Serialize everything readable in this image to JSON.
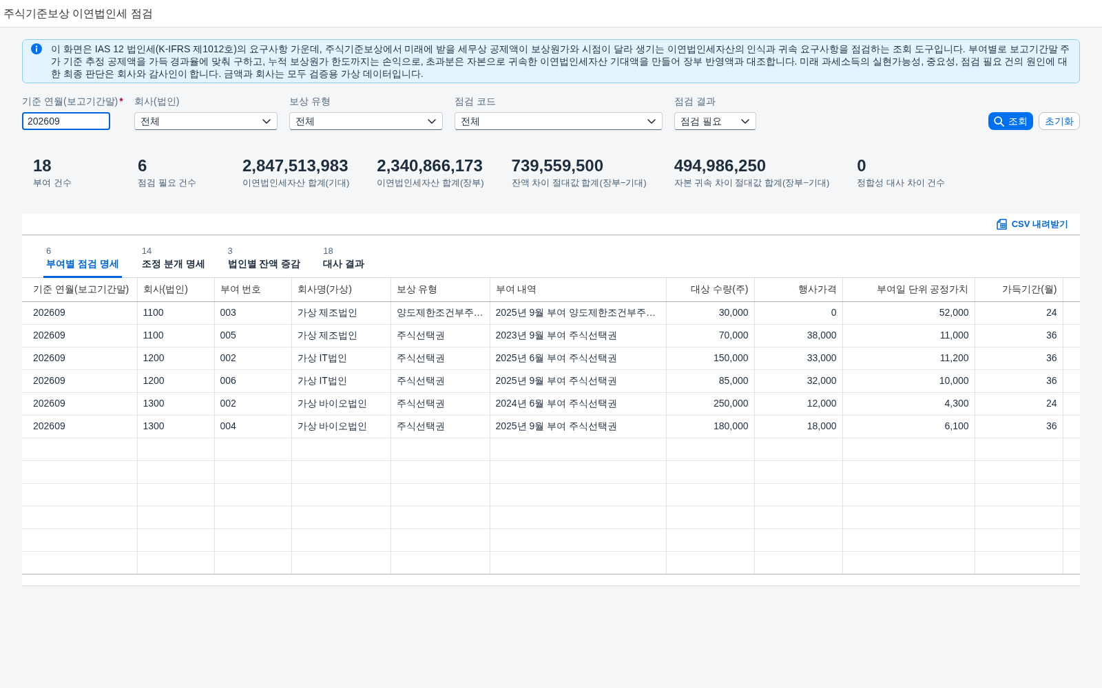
{
  "window": {
    "title": "주식기준보상 이연법인세 점검"
  },
  "info_banner": {
    "text": "이 화면은 IAS 12 법인세(K-IFRS 제1012호)의 요구사항 가운데, 주식기준보상에서 미래에 받을 세무상 공제액이 보상원가와 시점이 달라 생기는 이연법인세자산의 인식과 귀속 요구사항을 점검하는 조회 도구입니다. 부여별로 보고기간말 주가 기준 추정 공제액을 가득 경과율에 맞춰 구하고, 누적 보상원가 한도까지는 손익으로, 초과분은 자본으로 귀속한 이연법인세자산 기대액을 만들어 장부 반영액과 대조합니다. 미래 과세소득의 실현가능성, 중요성, 점검 필요 건의 원인에 대한 최종 판단은 회사와 감사인이 합니다. 금액과 회사는 모두 검증용 가상 데이터입니다."
  },
  "filters": [
    {
      "kind": "input",
      "label": "기준 연월(보고기간말)",
      "required_mark": "*",
      "value": "202609",
      "focused": true
    },
    {
      "kind": "select",
      "label": "회사(법인)",
      "value": "전체"
    },
    {
      "kind": "select",
      "label": "보상 유형",
      "value": "전체"
    },
    {
      "kind": "select",
      "label": "점검 코드",
      "value": "전체"
    },
    {
      "kind": "select",
      "label": "점검 결과",
      "value": "점검 필요"
    }
  ],
  "buttons": [
    {
      "kind": "search",
      "label": "조회"
    },
    {
      "kind": "reset",
      "label": "초기화"
    }
  ],
  "kpis": [
    {
      "value": "18",
      "label": "부여 건수"
    },
    {
      "value": "6",
      "label": "점검 필요 건수"
    },
    {
      "value": "2,847,513,983",
      "label": "이연법인세자산 합계(기대)"
    },
    {
      "value": "2,340,866,173",
      "label": "이연법인세자산 합계(장부)"
    },
    {
      "value": "739,559,500",
      "label": "잔액 차이 절대값 합계(장부−기대)"
    },
    {
      "value": "494,986,250",
      "label": "자본 귀속 차이 절대값 합계(장부−기대)"
    },
    {
      "value": "0",
      "label": "정합성 대사 차이 건수"
    }
  ],
  "table_toolbar": {
    "download_label": "CSV 내려받기"
  },
  "tabs": [
    {
      "count": "6",
      "label": "부여별 점검 명세",
      "selected": true
    },
    {
      "count": "14",
      "label": "조정 분개 명세",
      "selected": false
    },
    {
      "count": "3",
      "label": "법인별 잔액 증감",
      "selected": false
    },
    {
      "count": "18",
      "label": "대사 결과",
      "selected": false
    }
  ],
  "table": {
    "columns": [
      {
        "label": "기준 연월(보고기간말)",
        "kind": "text"
      },
      {
        "label": "회사(법인)",
        "kind": "text"
      },
      {
        "label": "부여 번호",
        "kind": "text"
      },
      {
        "label": "회사명(가상)",
        "kind": "text"
      },
      {
        "label": "보상 유형",
        "kind": "text"
      },
      {
        "label": "부여 내역",
        "kind": "text"
      },
      {
        "label": "대상 수량(주)",
        "kind": "number"
      },
      {
        "label": "행사가격",
        "kind": "number"
      },
      {
        "label": "부여일 단위 공정가치",
        "kind": "number"
      },
      {
        "label": "가득기간(월)",
        "kind": "number"
      }
    ],
    "rows": [
      [
        "202609",
        "1100",
        "003",
        "가상 제조법인",
        "양도제한조건부주…",
        "2025년 9월 부여 양도제한조건부주…",
        "30,000",
        "0",
        "52,000",
        "24"
      ],
      [
        "202609",
        "1100",
        "005",
        "가상 제조법인",
        "주식선택권",
        "2023년 9월 부여 주식선택권",
        "70,000",
        "38,000",
        "11,000",
        "36"
      ],
      [
        "202609",
        "1200",
        "002",
        "가상 IT법인",
        "주식선택권",
        "2025년 6월 부여 주식선택권",
        "150,000",
        "33,000",
        "11,200",
        "36"
      ],
      [
        "202609",
        "1200",
        "006",
        "가상 IT법인",
        "주식선택권",
        "2025년 9월 부여 주식선택권",
        "85,000",
        "32,000",
        "10,000",
        "36"
      ],
      [
        "202609",
        "1300",
        "002",
        "가상 바이오법인",
        "주식선택권",
        "2024년 6월 부여 주식선택권",
        "250,000",
        "12,000",
        "4,300",
        "24"
      ],
      [
        "202609",
        "1300",
        "004",
        "가상 바이오법인",
        "주식선택권",
        "2025년 9월 부여 주식선택권",
        "180,000",
        "18,000",
        "6,100",
        "36"
      ]
    ]
  }
}
